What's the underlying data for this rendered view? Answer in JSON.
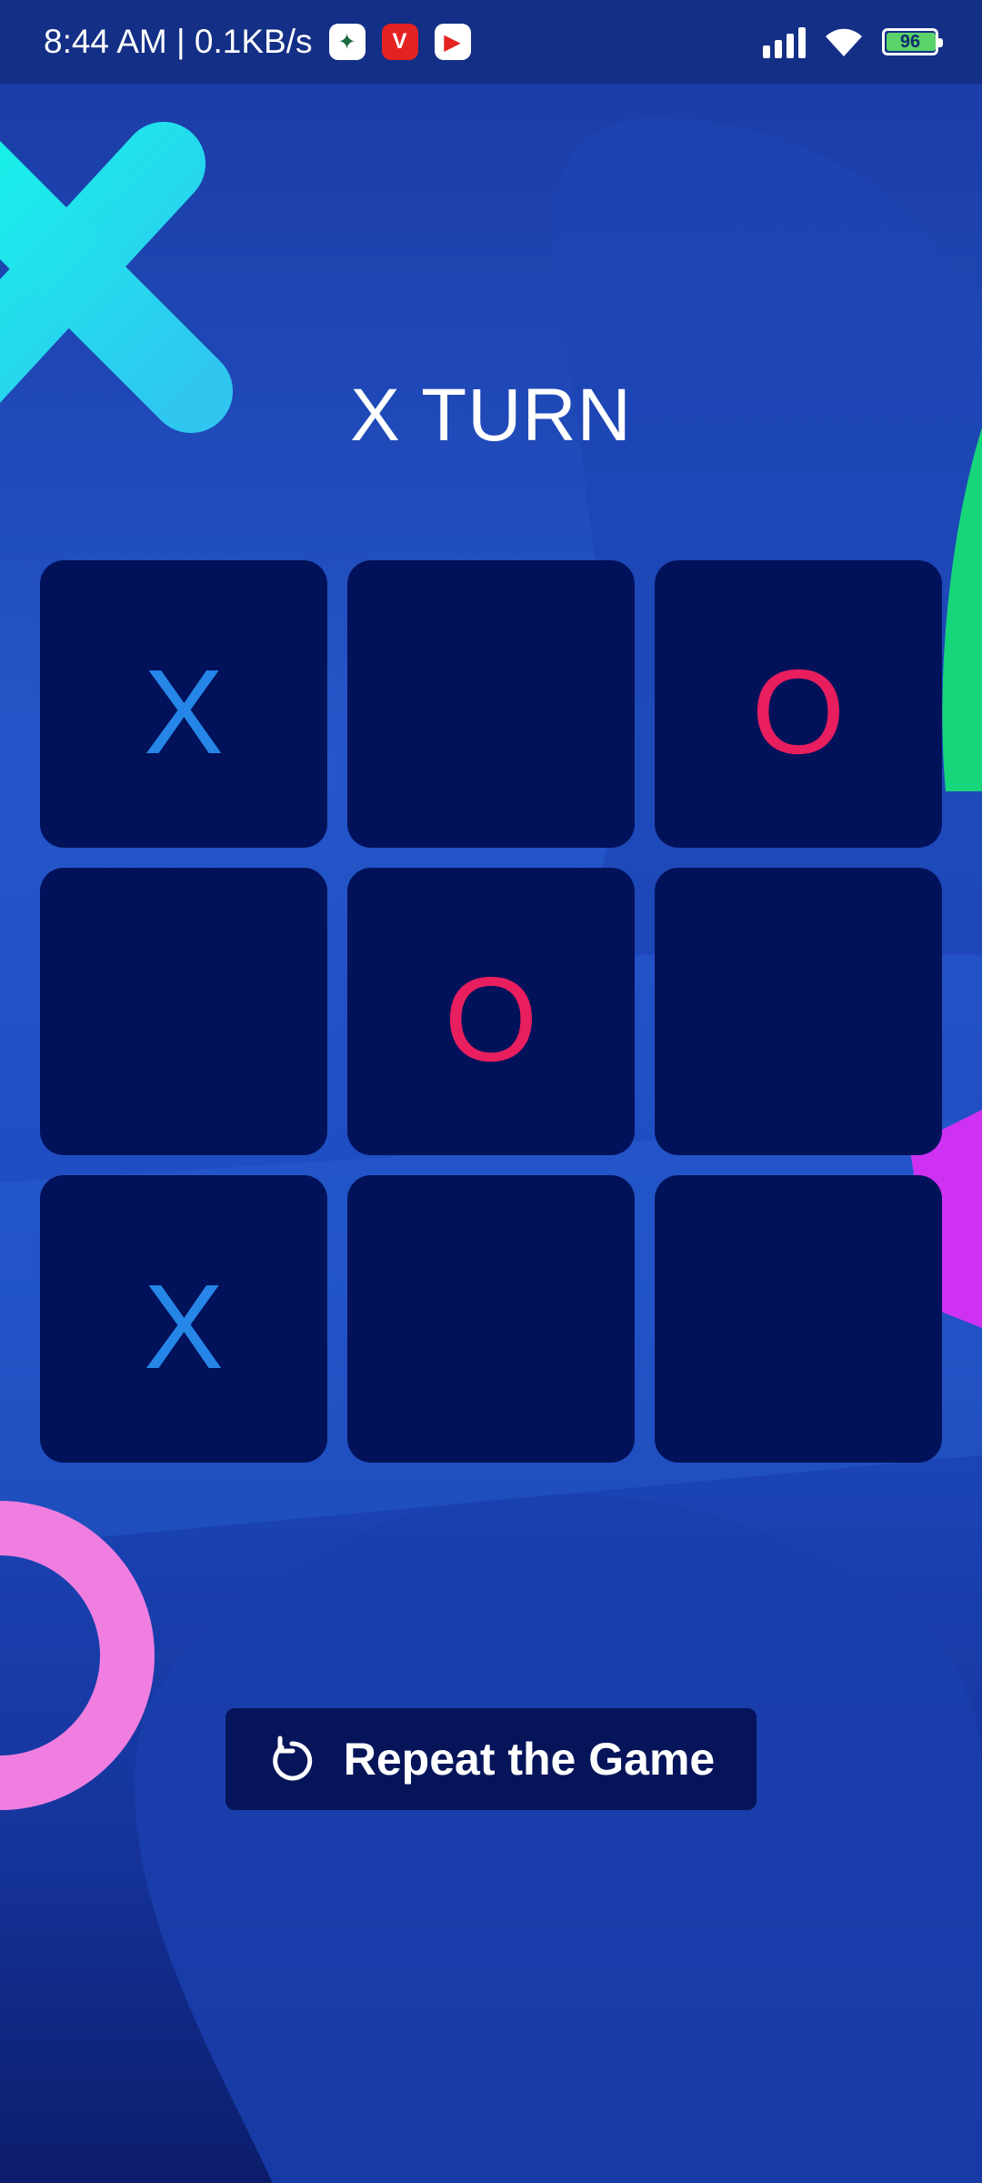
{
  "status_bar": {
    "time": "8:44 AM | 0.1KB/s",
    "battery": "96"
  },
  "game": {
    "turn_label": "X TURN",
    "board": [
      "X",
      "",
      "O",
      "",
      "O",
      "",
      "X",
      "",
      ""
    ]
  },
  "actions": {
    "repeat_label": "Repeat the Game"
  },
  "colors": {
    "x_mark": "#2586e8",
    "o_mark": "#e81e5e",
    "cell_bg": "#02125a",
    "background": "#2456c9"
  },
  "icons": {
    "repeat": "refresh-icon",
    "signal": "signal-icon",
    "wifi": "wifi-icon",
    "battery": "battery-icon"
  }
}
